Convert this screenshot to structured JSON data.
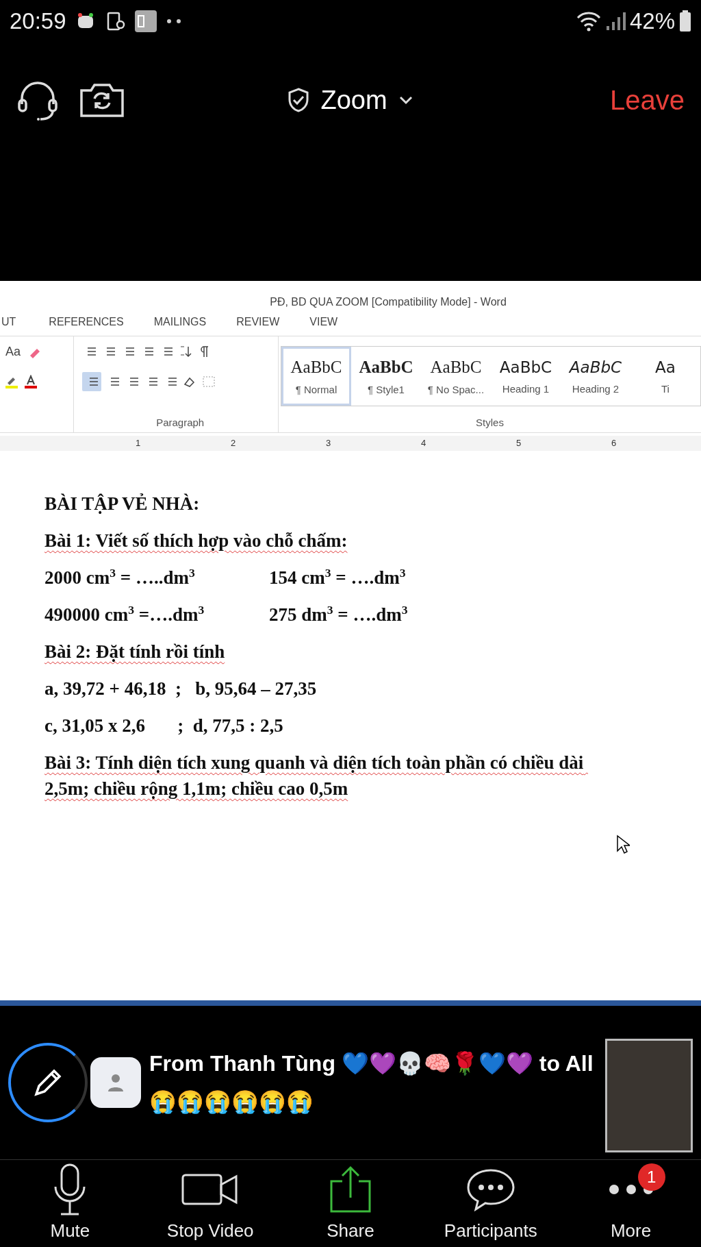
{
  "status_bar": {
    "time": "20:59",
    "battery": "42%"
  },
  "top_bar": {
    "title": "Zoom",
    "leave": "Leave"
  },
  "word": {
    "title": "PĐ, BD QUA ZOOM [Compatibility Mode] - Word",
    "tabs": [
      {
        "label": "UT",
        "selected": false
      },
      {
        "label": "REFERENCES",
        "selected": false
      },
      {
        "label": "MAILINGS",
        "selected": false
      },
      {
        "label": "REVIEW",
        "selected": false
      },
      {
        "label": "VIEW",
        "selected": false
      }
    ],
    "font_button": "Aa",
    "align_left_selected": true,
    "groups": [
      "Paragraph",
      "Styles"
    ],
    "styles": [
      {
        "preview": "AaBbC",
        "label": "¶ Normal",
        "selected": true,
        "kind": "serif"
      },
      {
        "preview": "AaBbC",
        "label": "¶ Style1",
        "selected": false,
        "kind": "serif-bold"
      },
      {
        "preview": "AaBbC",
        "label": "¶ No Spac...",
        "selected": false,
        "kind": "serif"
      },
      {
        "preview": "AaBbC",
        "label": "Heading 1",
        "selected": false,
        "kind": "sans"
      },
      {
        "preview": "AaBbC",
        "label": "Heading 2",
        "selected": false,
        "kind": "sans-italic"
      },
      {
        "preview": "Aa",
        "label": "Ti",
        "selected": false,
        "kind": "sans"
      }
    ],
    "ruler": [
      "1",
      "2",
      "3",
      "4",
      "5",
      "6"
    ],
    "document": [
      {
        "kind": "line",
        "text": "BÀI TẬP VẺ NHÀ:",
        "spellcheck": false
      },
      {
        "kind": "line",
        "text": "Bài 1: Viết số thích hợp vào chỗ chấm:",
        "spellcheck": true
      },
      {
        "kind": "pair",
        "left": "2000 cm$^{3}$ = …..dm$^{3}$",
        "right": "154 cm$^{3}$ = ….dm$^{3}$"
      },
      {
        "kind": "pair",
        "left": "490000 cm$^{3}$ =….dm$^{3}$",
        "right": "275 dm$^{3}$ = ….dm$^{3}$"
      },
      {
        "kind": "line",
        "text": "Bài 2: Đặt tính rồi tính",
        "spellcheck": true
      },
      {
        "kind": "line",
        "text": "a, 39,72 + 46,18  ;   b, 95,64 – 27,35",
        "spellcheck": false
      },
      {
        "kind": "line",
        "text": "c, 31,05 x 2,6       ;  d, 77,5 : 2,5",
        "spellcheck": false
      },
      {
        "kind": "line",
        "text": "Bài 3: Tính diện tích xung quanh và diện tích toàn phần có chiều dài 2,5m; chiều rộng 1,1m; chiều cao 0,5m",
        "spellcheck": true
      }
    ]
  },
  "chat": {
    "message": "From Thanh Tùng 💙💜💀🧠🌹💙💜 to All 😭😭😭😭😭😭"
  },
  "toolbar": [
    {
      "label": "Mute",
      "kind": "mic"
    },
    {
      "label": "Stop Video",
      "kind": "video"
    },
    {
      "label": "Share",
      "kind": "share"
    },
    {
      "label": "Participants",
      "kind": "chat"
    },
    {
      "label": "More",
      "kind": "more",
      "badge": "1"
    }
  ]
}
